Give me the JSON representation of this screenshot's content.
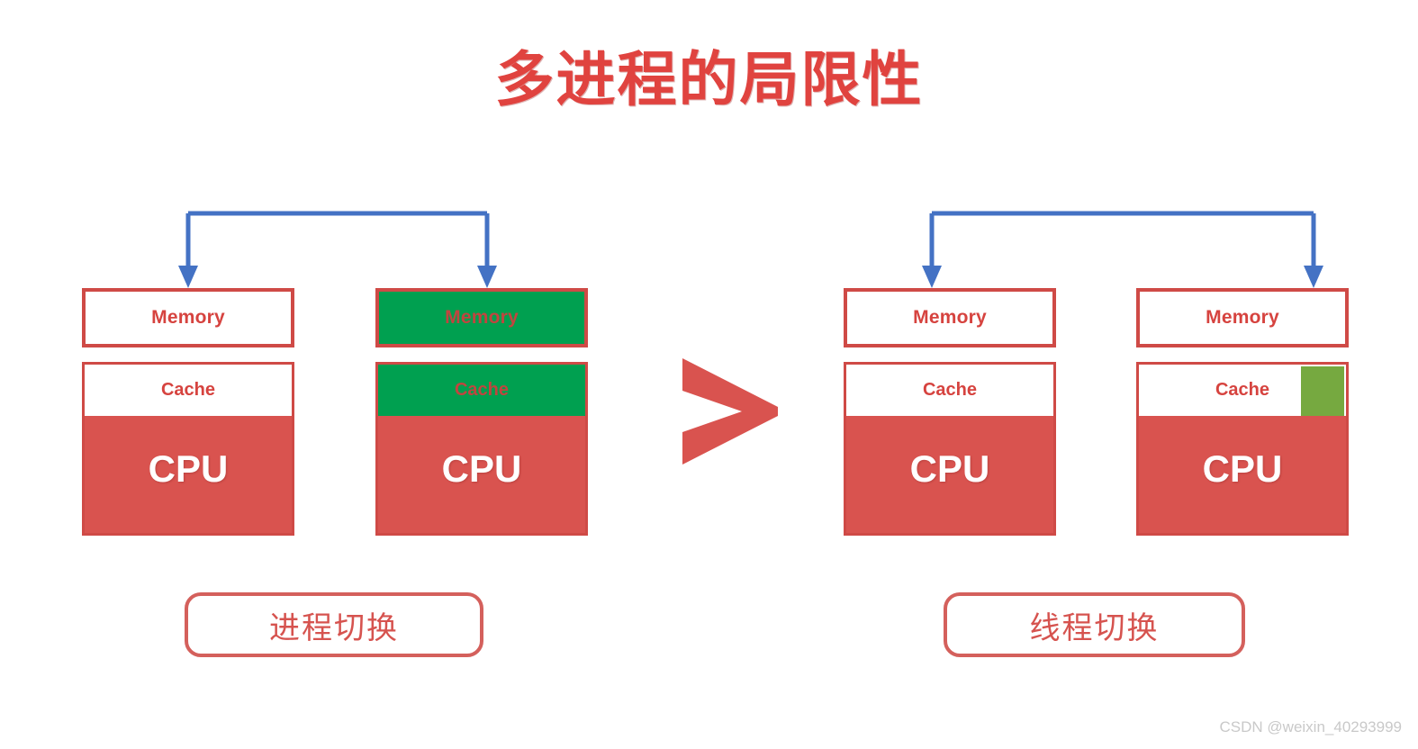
{
  "page": {
    "title": "多进程的局限性",
    "background_color": "#ffffff"
  },
  "colors": {
    "title_red": "#e0433f",
    "cpu_red": "#d9534f",
    "border_red": "#cf4a46",
    "label_red": "#d6534f",
    "emerald_green": "#00a050",
    "olive_green": "#76a940",
    "arrow_blue": "#4472c4",
    "watermark_gray": "#c9c9c9"
  },
  "comparison": {
    "symbol": ">",
    "meaning": "greater-than"
  },
  "left_group": {
    "caption": "进程切换",
    "connector_icon": "bracket-down-arrow",
    "blocks": [
      {
        "memory_label": "Memory",
        "memory_filled": false,
        "cache_label": "Cache",
        "cache_filled": false,
        "cache_chunk": false,
        "cpu_label": "CPU"
      },
      {
        "memory_label": "Memory",
        "memory_filled": true,
        "cache_label": "Cache",
        "cache_filled": true,
        "cache_chunk": false,
        "cpu_label": "CPU"
      }
    ]
  },
  "right_group": {
    "caption": "线程切换",
    "connector_icon": "bracket-down-arrow",
    "blocks": [
      {
        "memory_label": "Memory",
        "memory_filled": false,
        "cache_label": "Cache",
        "cache_filled": false,
        "cache_chunk": false,
        "cpu_label": "CPU"
      },
      {
        "memory_label": "Memory",
        "memory_filled": false,
        "cache_label": "Cache",
        "cache_filled": false,
        "cache_chunk": true,
        "cpu_label": "CPU"
      }
    ]
  },
  "watermark": {
    "text": "CSDN @weixin_40293999"
  }
}
